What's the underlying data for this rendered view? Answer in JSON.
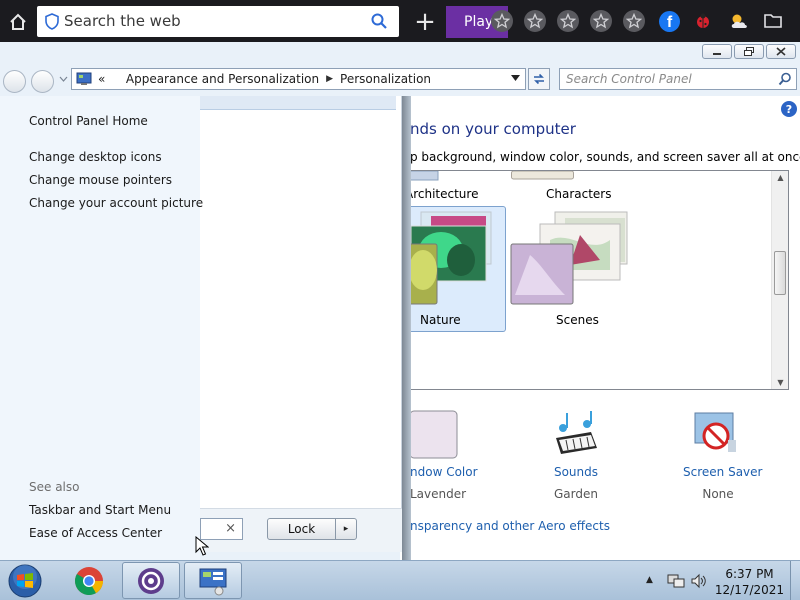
{
  "browser": {
    "search_placeholder": "Search the web",
    "play_label": "Play",
    "favorites_count": 5,
    "icons": [
      "home-icon",
      "shield-icon",
      "search-icon",
      "plus-icon",
      "star-icon",
      "facebook-icon",
      "ladybug-icon",
      "weather-icon",
      "folder-icon"
    ],
    "facebook_letter": "f",
    "accent_color": "#6b2fa3"
  },
  "window": {
    "breadcrumb_prefix": "«",
    "breadcrumb": [
      "Appearance and Personalization",
      "Personalization"
    ],
    "search_placeholder": "Search Control Panel",
    "help_label": "?"
  },
  "content": {
    "heading": "nds on your computer",
    "subheading": "p background, window color, sounds, and screen saver all at once.",
    "themes": [
      {
        "name": "Architecture",
        "selected": false
      },
      {
        "name": "Characters",
        "selected": false
      },
      {
        "name": "Nature",
        "selected": true
      },
      {
        "name": "Scenes",
        "selected": false
      }
    ],
    "window_color": {
      "title": "ndow Color",
      "value": "Lavender"
    },
    "sounds": {
      "title": "Sounds",
      "value": "Garden"
    },
    "screen_saver": {
      "title": "Screen Saver",
      "value": "None"
    },
    "aero_link": "nsparency and other Aero effects"
  },
  "start_menu": {
    "links": [
      "Control Panel Home",
      "Change desktop icons",
      "Change mouse pointers",
      "Change your account picture"
    ],
    "see_also_label": "See also",
    "see_also": [
      "Taskbar and Start Menu",
      "Ease of Access Center"
    ],
    "search_clear": "×",
    "lock_label": "Lock",
    "lock_arrow": "▸"
  },
  "taskbar": {
    "time": "6:37 PM",
    "date": "12/17/2021",
    "tray_arrow": "▲",
    "pinned": [
      "start-orb",
      "chrome-icon",
      "app-icon",
      "control-panel-icon"
    ]
  }
}
